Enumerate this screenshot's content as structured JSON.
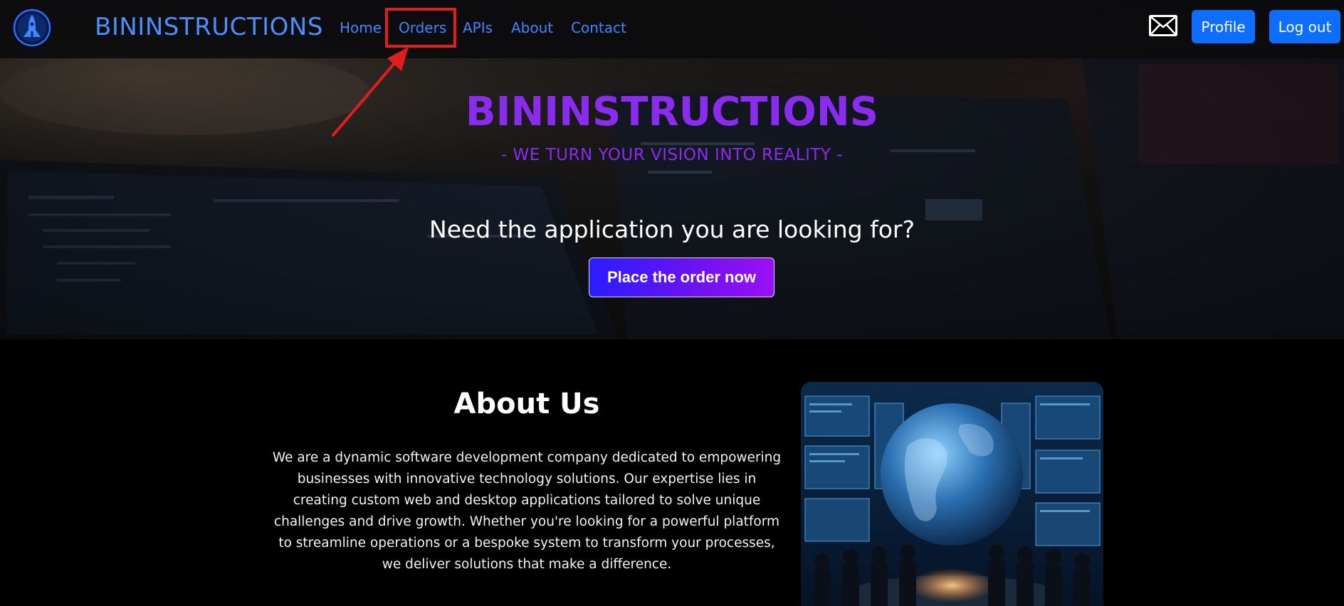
{
  "navbar": {
    "brand": "BININSTRUCTIONS",
    "links": [
      {
        "label": "Home"
      },
      {
        "label": "Orders"
      },
      {
        "label": "APIs"
      },
      {
        "label": "About"
      },
      {
        "label": "Contact"
      }
    ],
    "profile_label": "Profile",
    "logout_label": "Log out",
    "icons": {
      "logo": "rocket-logo-icon",
      "mail": "envelope-icon"
    }
  },
  "hero": {
    "title": "BININSTRUCTIONS",
    "tagline": "- WE TURN YOUR VISION INTO REALITY -",
    "question": "Need the application you are looking for?",
    "cta_label": "Place the order now"
  },
  "about": {
    "title": "About Us",
    "text": "We are a dynamic software development company dedicated to empowering businesses with innovative technology solutions. Our expertise lies in creating custom web and desktop applications tailored to solve unique challenges and drive growth. Whether you're looking for a powerful platform to streamline operations or a bespoke system to transform your processes, we deliver solutions that make a difference."
  },
  "colors": {
    "accent_blue": "#0d6efd",
    "link_blue": "#3f86ff",
    "hero_purple": "#8a2cf0",
    "highlight_red": "#e11d1d"
  }
}
